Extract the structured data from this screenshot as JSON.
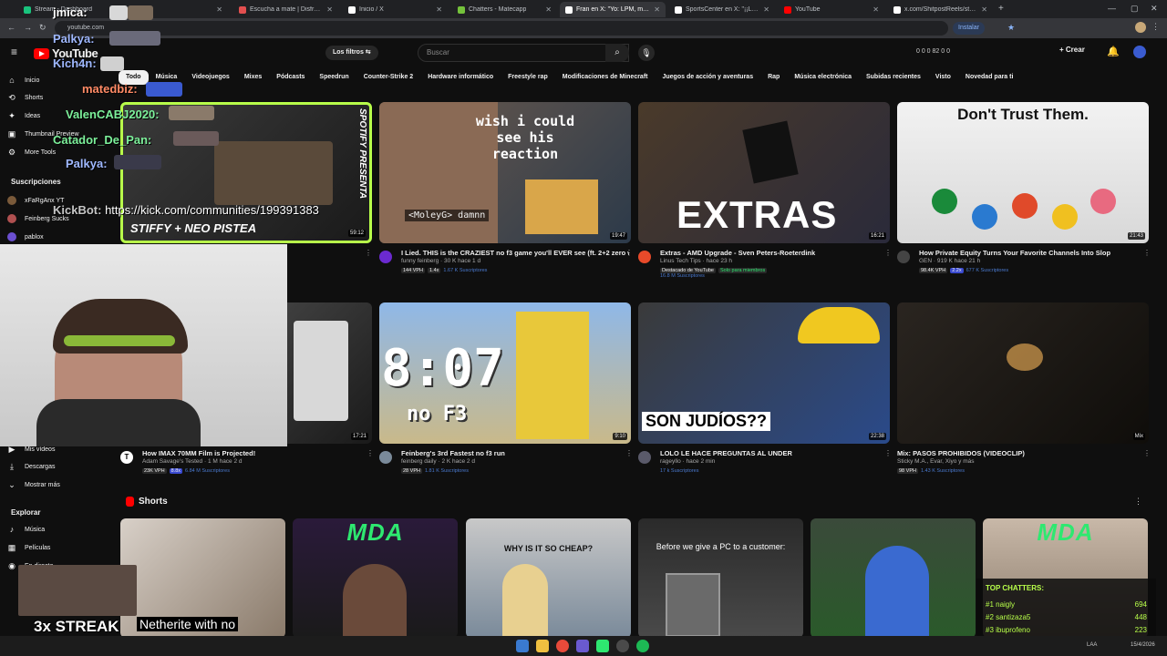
{
  "browser": {
    "tabs": [
      {
        "label": "Stream - Dashboard",
        "color": "#19c37d"
      },
      {
        "label": "Escucha a mate | Disfruta de la",
        "color": "#e34f4f"
      },
      {
        "label": "Inicio / X",
        "color": "#ffffff"
      },
      {
        "label": "Chatters - Matecapp",
        "color": "#74c23b"
      },
      {
        "label": "Fran en X: \"Yo: LPM, me pierdo",
        "color": "#ffffff"
      },
      {
        "label": "SportsCenter en X: \"¡¡LOCURA",
        "color": "#ffffff"
      },
      {
        "label": "YouTube",
        "color": "#ff0000"
      },
      {
        "label": "x.com/ShitpostReels/status/20",
        "color": "#ffffff"
      }
    ],
    "new_tab": "+",
    "url": "youtube.com",
    "install_label": "Instalar"
  },
  "youtube": {
    "logo_text": "YouTube",
    "filters_label": "Los filtros",
    "search_placeholder": "Buscar",
    "create_label": "Crear",
    "counters": "0  0  0  82  0  0",
    "chips": [
      "Todo",
      "Música",
      "Videojuegos",
      "Mixes",
      "Pódcasts",
      "Speedrun",
      "Counter-Strike 2",
      "Hardware informático",
      "Freestyle rap",
      "Modificaciones de Minecraft",
      "Juegos de acción y aventuras",
      "Rap",
      "Música electrónica",
      "Subidas recientes",
      "Visto",
      "Novedad para ti"
    ],
    "sidebar": {
      "items": [
        "Inicio",
        "Shorts",
        "Ideas",
        "Thumbnail Preview",
        "More Tools"
      ],
      "subs_heading": "Suscripciones",
      "subs": [
        "xFaRgAnx YT",
        "Feinberg Sucks",
        "pablox"
      ],
      "lower": [
        "Mis vídeos",
        "Descargas",
        "Mostrar más"
      ],
      "explore_heading": "Explorar",
      "explore": [
        "Música",
        "Películas",
        "En directo"
      ]
    },
    "videos_row1": [
      {
        "title": "",
        "channel": "",
        "duration": "59:12",
        "thumb_text": "STIFFY + NEO PISTEA",
        "side_text": "SPOTIFY PRESENTA"
      },
      {
        "title": "I Lied. THIS is the CRAZIEST no f3 game you'll EVER see (ft. 2+2 zero without f3)",
        "channel": "funny feinberg · 30 K  hace 1 d",
        "stats": [
          "144 VPH",
          "1.4x",
          "1.67 K Suscriptores"
        ],
        "duration": "19:47",
        "thumb_text": "wish i could see his reaction",
        "caption": "<MoleyG> damnn"
      },
      {
        "title": "Extras - AMD Upgrade - Sven Peters-Roeterdink",
        "channel": "Linus Tech Tips · hace 23 h",
        "stats": [
          "Destacado de YouTube",
          "Solo para miembros",
          "16.8 M Suscriptores"
        ],
        "duration": "16:21",
        "thumb_text": "EXTRAS"
      },
      {
        "title": "How Private Equity Turns Your Favorite Channels Into Slop",
        "channel": "GEN · 919 K  hace 21 h",
        "stats": [
          "98.4K VPH",
          "2.2x",
          "677 K Suscriptores"
        ],
        "duration": "21:43",
        "thumb_text": "Don't Trust Them."
      }
    ],
    "videos_row2": [
      {
        "title": "How IMAX 70MM Film is Projected!",
        "channel": "Adam Savage's Tested · 1 M  hace 2 d",
        "stats": [
          "23K VPH",
          "8.8x",
          "6.84 M Suscriptores"
        ],
        "duration": "17:21"
      },
      {
        "title": "Feinberg's 3rd Fastest no f3 run",
        "channel": "feinberg daily · 2 K  hace 2 d",
        "stats": [
          "28 VPH",
          "1.81 K Suscriptores"
        ],
        "duration": "9:10",
        "thumb_text": "8:07",
        "thumb_sub": "no F3"
      },
      {
        "title": "LOLO LE HACE PREGUNTAS AL UNDER",
        "channel": "rageyllo · hace 2 min",
        "stats": [
          "17 k Suscriptores"
        ],
        "duration": "22:38",
        "thumb_text": "SON JUDÍOS??"
      },
      {
        "title": "Mix: PASOS PROHIBIDOS (VIDEOCLIP)",
        "channel": "Sticky M.A., Evar, Xiyo y más",
        "stats": [
          "98 VPH",
          "1.43 K Suscriptores"
        ],
        "duration": "Mix"
      }
    ],
    "shorts_heading": "Shorts",
    "shorts": [
      {
        "text": "Netherite with no"
      },
      {
        "text": "MDA"
      },
      {
        "text": "WHY IS IT SO CHEAP?"
      },
      {
        "text": "Before we give a PC to a customer:"
      },
      {
        "text": ""
      },
      {
        "text": "MDA"
      }
    ]
  },
  "overlay": {
    "chat": [
      {
        "user": "jmica:",
        "color": "#ffffff"
      },
      {
        "user": "Palkya:",
        "color": "#9fb8ff"
      },
      {
        "user": "Kich4n:",
        "color": "#9fb8ff"
      },
      {
        "user": "matedbiz:",
        "color": "#ff8a65"
      },
      {
        "user": "ValenCABJ2020:",
        "color": "#7cf09a"
      },
      {
        "user": "Catador_De_Pan:",
        "color": "#7cf09a"
      },
      {
        "user": "Palkya:",
        "color": "#9fb8ff"
      },
      {
        "user": "KickBot:",
        "color": "#c6c6c6",
        "message": "https://kick.com/communities/199391383"
      }
    ],
    "streak": "3x STREAK",
    "top_chatters_title": "TOP CHATTERS:",
    "top_chatters": [
      {
        "rank": "#1 naigly",
        "count": "694"
      },
      {
        "rank": "#2 santizaza5",
        "count": "448"
      },
      {
        "rank": "#3 ibuprofeno",
        "count": "223"
      }
    ]
  },
  "taskbar": {
    "lang": "LAA",
    "date": "15/4/2026"
  }
}
